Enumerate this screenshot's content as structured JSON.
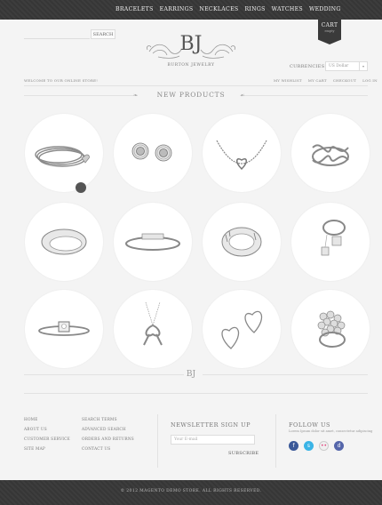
{
  "nav": {
    "items": [
      "BRACELETS",
      "EARRINGS",
      "NECKLACES",
      "RINGS",
      "WATCHES",
      "WEDDING"
    ]
  },
  "cart": {
    "label": "CART",
    "sub": "empty"
  },
  "search": {
    "button": "SEARCH",
    "placeholder": ""
  },
  "logo": {
    "mark": "BJ",
    "tagline": "BURTON JEWELRY"
  },
  "currency": {
    "label": "CURRENCIES",
    "selected": "US Dollar"
  },
  "welcome": "WELCOME TO OUR ONLINE STORE!",
  "account_links": [
    "MY WISHLIST",
    "MY CART",
    "CHECKOUT",
    "LOG IN"
  ],
  "section": {
    "title": "NEW PRODUCTS"
  },
  "products": [
    {
      "icon": "bracelet-icon"
    },
    {
      "icon": "earrings-icon"
    },
    {
      "icon": "necklace-icon"
    },
    {
      "icon": "infinity-ring-icon"
    },
    {
      "icon": "band-ring-icon"
    },
    {
      "icon": "cuff-bracelet-icon"
    },
    {
      "icon": "roman-ring-icon"
    },
    {
      "icon": "tag-ring-icon"
    },
    {
      "icon": "square-ring-icon"
    },
    {
      "icon": "ribbon-pendant-icon"
    },
    {
      "icon": "heart-earrings-icon"
    },
    {
      "icon": "bead-ring-icon"
    }
  ],
  "footer": {
    "mark": "BJ",
    "col1": [
      "HOME",
      "ABOUT US",
      "CUSTOMER SERVICE",
      "SITE MAP"
    ],
    "col2": [
      "SEARCH TERMS",
      "ADVANCED SEARCH",
      "ORDERS AND RETURNS",
      "CONTACT US"
    ],
    "newsletter": {
      "title": "NEWSLETTER SIGN UP",
      "placeholder": "Your E-mail",
      "button": "SUBSCRIBE"
    },
    "follow": {
      "title": "FOLLOW US",
      "sub": "Lorem Ipsum dolor sit amet, consectetur adipiscing"
    },
    "social": [
      {
        "icon": "facebook-icon",
        "glyph": "f",
        "color": "#3b5998"
      },
      {
        "icon": "skype-icon",
        "glyph": "s",
        "color": "#3ab4e6"
      },
      {
        "icon": "flickr-icon",
        "glyph": "••",
        "color": "#f0f0f0"
      },
      {
        "icon": "delicious-icon",
        "glyph": "d",
        "color": "#5566aa"
      }
    ],
    "copyright": "© 2012 MAGENTO DEMO STORE. ALL RIGHTS RESERVED."
  }
}
